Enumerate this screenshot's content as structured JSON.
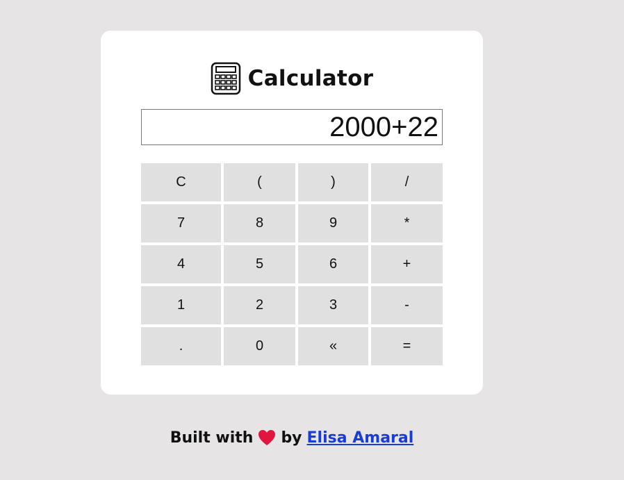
{
  "app": {
    "title": "Calculator",
    "icon": "calculator-icon"
  },
  "display": {
    "value": "2000+22"
  },
  "keys": [
    {
      "label": "C",
      "name": "clear-button"
    },
    {
      "label": "(",
      "name": "open-paren-button"
    },
    {
      "label": ")",
      "name": "close-paren-button"
    },
    {
      "label": "/",
      "name": "divide-button"
    },
    {
      "label": "7",
      "name": "digit-7-button"
    },
    {
      "label": "8",
      "name": "digit-8-button"
    },
    {
      "label": "9",
      "name": "digit-9-button"
    },
    {
      "label": "*",
      "name": "multiply-button"
    },
    {
      "label": "4",
      "name": "digit-4-button"
    },
    {
      "label": "5",
      "name": "digit-5-button"
    },
    {
      "label": "6",
      "name": "digit-6-button"
    },
    {
      "label": "+",
      "name": "plus-button"
    },
    {
      "label": "1",
      "name": "digit-1-button"
    },
    {
      "label": "2",
      "name": "digit-2-button"
    },
    {
      "label": "3",
      "name": "digit-3-button"
    },
    {
      "label": "-",
      "name": "minus-button"
    },
    {
      "label": ".",
      "name": "decimal-button"
    },
    {
      "label": "0",
      "name": "digit-0-button"
    },
    {
      "label": "«",
      "name": "backspace-button"
    },
    {
      "label": "=",
      "name": "equals-button"
    }
  ],
  "footer": {
    "prefix": "Built with",
    "heart_icon": "heart-icon",
    "by": "by",
    "author": "Elisa Amaral"
  },
  "colors": {
    "page_background": "#e6e4e5",
    "card_background": "#ffffff",
    "key_background": "#e0e0e0",
    "heart": "#e0163f",
    "link": "#1a3cd6"
  }
}
